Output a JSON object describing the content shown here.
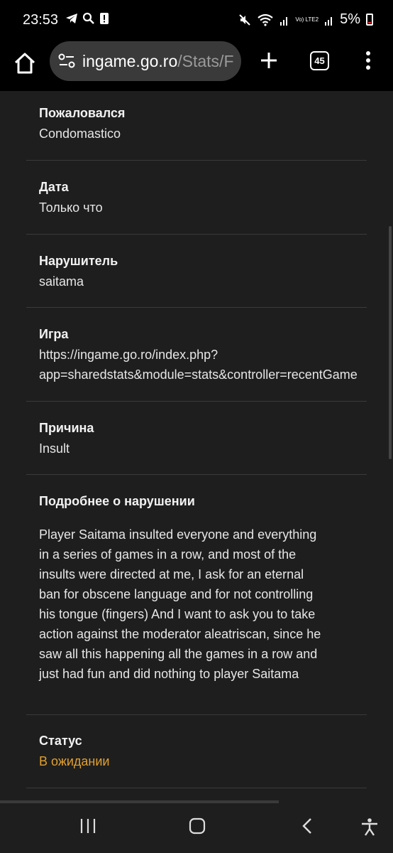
{
  "status_bar": {
    "time": "23:53",
    "battery_percent": "5%",
    "network_label": "Vo) LTE2",
    "icons": [
      "telegram-icon",
      "search-icon",
      "alert-icon",
      "mute-icon",
      "wifi-icon",
      "signal-icon",
      "battery-icon"
    ]
  },
  "browser": {
    "url_host": "ingame.go.ro",
    "url_path": "/Stats/F",
    "tab_count": "45",
    "icons": [
      "home-icon",
      "site-info-icon",
      "plus-icon",
      "tabs-icon",
      "menu-icon"
    ]
  },
  "report": {
    "reporter": {
      "label": "Пожаловался",
      "value": "Condomastico"
    },
    "date": {
      "label": "Дата",
      "value": "Только что"
    },
    "offender": {
      "label": "Нарушитель",
      "value": "saitama"
    },
    "game": {
      "label": "Игра",
      "value_line1": "https://ingame.go.ro/index.php?",
      "value_line2": "app=sharedstats&module=stats&controller=recentGame"
    },
    "reason": {
      "label": "Причина",
      "value": "Insult"
    },
    "details": {
      "label": "Подробнее о нарушении",
      "text": "Player Saitama insulted everyone and everything\nin a series of games in a row, and most of the\ninsults were directed at me, I ask for an eternal\nban for obscene language and for not controlling\nhis tongue (fingers) And I want to ask you to take\naction against the moderator aleatriscan, since he\nsaw all this happening all the games in a row and\njust had fun and did nothing to player Saitama"
    },
    "status": {
      "label": "Статус",
      "value": "В ожидании",
      "color": "#e0a030"
    }
  },
  "nav_bar": {
    "icons": [
      "recent-apps-icon",
      "home-nav-icon",
      "back-icon",
      "accessibility-icon"
    ]
  }
}
